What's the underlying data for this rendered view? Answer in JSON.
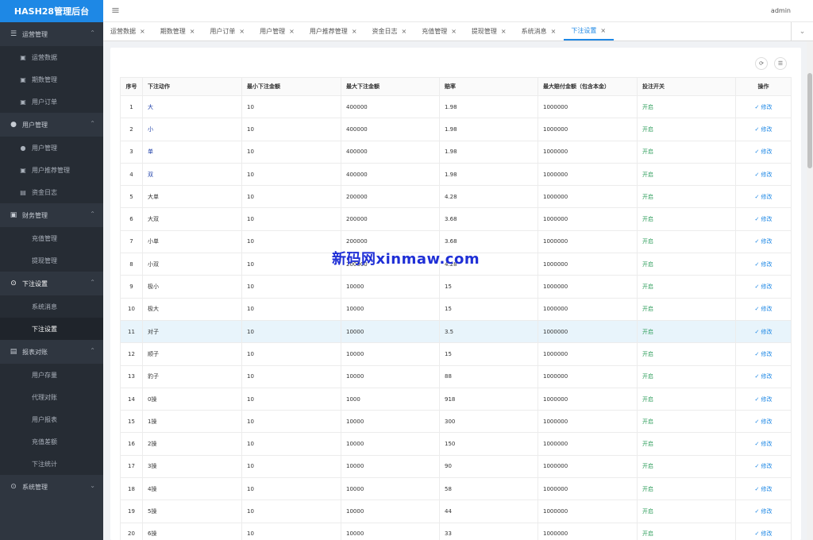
{
  "app": {
    "title": "HASH28管理后台"
  },
  "header": {
    "user": "admin"
  },
  "sidebar": {
    "groups": [
      {
        "label": "运营管理",
        "icon": "list-icon",
        "items": [
          {
            "label": "运营数据",
            "icon": "image-icon"
          },
          {
            "label": "期数管理",
            "icon": "image-icon"
          },
          {
            "label": "用户订单",
            "icon": "image-icon"
          }
        ]
      },
      {
        "label": "用户管理",
        "icon": "user-icon",
        "items": [
          {
            "label": "用户管理",
            "icon": "user-icon"
          },
          {
            "label": "用户推荐管理",
            "icon": "image-icon"
          },
          {
            "label": "资金日志",
            "icon": "doc-icon"
          }
        ]
      },
      {
        "label": "财务管理",
        "icon": "image-icon",
        "items": [
          {
            "label": "充值管理"
          },
          {
            "label": "提现管理"
          }
        ]
      },
      {
        "label": "下注设置",
        "icon": "settings-icon",
        "items": [
          {
            "label": "系统消息"
          },
          {
            "label": "下注设置"
          }
        ]
      },
      {
        "label": "报表对账",
        "icon": "doc-icon",
        "items": [
          {
            "label": "用户存量"
          },
          {
            "label": "代理对账"
          },
          {
            "label": "用户报表"
          },
          {
            "label": "充值差额"
          },
          {
            "label": "下注统计"
          }
        ]
      },
      {
        "label": "系统管理",
        "icon": "settings-icon",
        "items": []
      }
    ]
  },
  "tabs": [
    "运营数据",
    "期数管理",
    "用户订单",
    "用户管理",
    "用户推荐管理",
    "资金日志",
    "充值管理",
    "提现管理",
    "系统消息",
    "下注设置"
  ],
  "active_tab": "下注设置",
  "table": {
    "headers": [
      "序号",
      "下注动作",
      "最小下注金额",
      "最大下注金额",
      "赔率",
      "最大赔付金额（包含本金）",
      "投注开关",
      "操作"
    ],
    "rows": [
      [
        "1",
        "大",
        "10",
        "400000",
        "1.98",
        "1000000",
        "开启",
        "修改"
      ],
      [
        "2",
        "小",
        "10",
        "400000",
        "1.98",
        "1000000",
        "开启",
        "修改"
      ],
      [
        "3",
        "单",
        "10",
        "400000",
        "1.98",
        "1000000",
        "开启",
        "修改"
      ],
      [
        "4",
        "双",
        "10",
        "400000",
        "1.98",
        "1000000",
        "开启",
        "修改"
      ],
      [
        "5",
        "大单",
        "10",
        "200000",
        "4.28",
        "1000000",
        "开启",
        "修改"
      ],
      [
        "6",
        "大双",
        "10",
        "200000",
        "3.68",
        "1000000",
        "开启",
        "修改"
      ],
      [
        "7",
        "小单",
        "10",
        "200000",
        "3.68",
        "1000000",
        "开启",
        "修改"
      ],
      [
        "8",
        "小双",
        "10",
        "200000",
        "4.28",
        "1000000",
        "开启",
        "修改"
      ],
      [
        "9",
        "极小",
        "10",
        "10000",
        "15",
        "1000000",
        "开启",
        "修改"
      ],
      [
        "10",
        "极大",
        "10",
        "10000",
        "15",
        "1000000",
        "开启",
        "修改"
      ],
      [
        "11",
        "对子",
        "10",
        "10000",
        "3.5",
        "1000000",
        "开启",
        "修改"
      ],
      [
        "12",
        "顺子",
        "10",
        "10000",
        "15",
        "1000000",
        "开启",
        "修改"
      ],
      [
        "13",
        "豹子",
        "10",
        "10000",
        "88",
        "1000000",
        "开启",
        "修改"
      ],
      [
        "14",
        "0操",
        "10",
        "1000",
        "918",
        "1000000",
        "开启",
        "修改"
      ],
      [
        "15",
        "1操",
        "10",
        "10000",
        "300",
        "1000000",
        "开启",
        "修改"
      ],
      [
        "16",
        "2操",
        "10",
        "10000",
        "150",
        "1000000",
        "开启",
        "修改"
      ],
      [
        "17",
        "3操",
        "10",
        "10000",
        "90",
        "1000000",
        "开启",
        "修改"
      ],
      [
        "18",
        "4操",
        "10",
        "10000",
        "58",
        "1000000",
        "开启",
        "修改"
      ],
      [
        "19",
        "5操",
        "10",
        "10000",
        "44",
        "1000000",
        "开启",
        "修改"
      ],
      [
        "20",
        "6操",
        "10",
        "10000",
        "33",
        "1000000",
        "开启",
        "修改"
      ]
    ],
    "highlight_row": 11
  },
  "watermark": "新码网xinmaw.com",
  "colors": {
    "accent": "#1e88e5",
    "sidebar": "#2f3640",
    "on": "#2e9e5b",
    "action_blue": "#1e3fa8"
  }
}
